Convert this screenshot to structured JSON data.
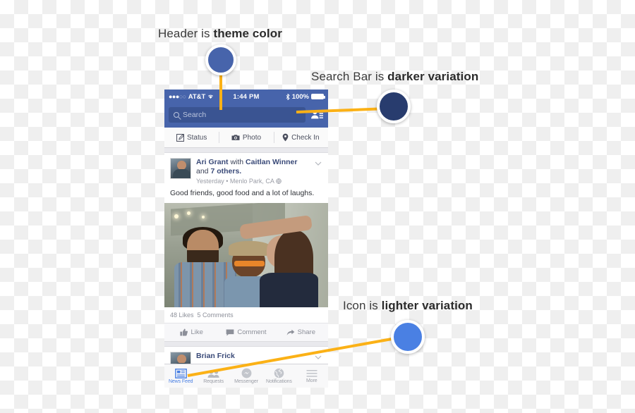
{
  "annotations": [
    {
      "id": "header",
      "plain": "Header is ",
      "emphasis": "theme color",
      "swatch_color": "#4764ab"
    },
    {
      "id": "search",
      "plain": "Search Bar is ",
      "emphasis": "darker variation",
      "swatch_color": "#283c6e"
    },
    {
      "id": "icon",
      "plain": "Icon is ",
      "emphasis": "lighter variation",
      "swatch_color": "#4a80e3"
    }
  ],
  "phone": {
    "status_bar": {
      "signal_dots_filled": 3,
      "signal_dots_hollow": 2,
      "carrier": "AT&T",
      "wifi_icon": "wifi-icon",
      "time": "1:44 PM",
      "bluetooth_icon": "bluetooth-icon",
      "battery_percent": "100%",
      "battery_icon": "battery-full-icon"
    },
    "header": {
      "background_color": "#4764ab",
      "search": {
        "icon": "search-icon",
        "placeholder": "Search",
        "value": "",
        "background_color": "#3a5492"
      },
      "friend_requests_icon": "friend-requests-icon"
    },
    "composer": [
      {
        "icon": "status-compose-icon",
        "label": "Status"
      },
      {
        "icon": "camera-icon",
        "label": "Photo"
      },
      {
        "icon": "location-pin-icon",
        "label": "Check In"
      }
    ],
    "feed": [
      {
        "author": "Ari Grant",
        "with_text": "with",
        "cotag": "Caitlan Winner",
        "and_text": "and",
        "others": "7 others.",
        "timestamp": "Yesterday",
        "separator": "•",
        "location": "Menlo Park, CA",
        "privacy_icon": "globe-icon",
        "chevron_icon": "chevron-down-icon",
        "body": "Good friends, good food and a lot of laughs.",
        "photo_alt": "three-friends-photo",
        "likes": "48 Likes",
        "comments": "5 Comments",
        "actions": [
          {
            "icon": "thumbs-up-icon",
            "label": "Like"
          },
          {
            "icon": "comment-bubble-icon",
            "label": "Comment"
          },
          {
            "icon": "share-arrow-icon",
            "label": "Share"
          }
        ]
      },
      {
        "author": "Brian Frick",
        "chevron_icon": "chevron-down-icon"
      }
    ],
    "tabbar": [
      {
        "icon": "news-feed-icon",
        "label": "News Feed",
        "active": true
      },
      {
        "icon": "friend-requests-icon",
        "label": "Requests",
        "active": false
      },
      {
        "icon": "messenger-icon",
        "label": "Messenger",
        "active": false
      },
      {
        "icon": "globe-notifications-icon",
        "label": "Notifications",
        "active": false
      },
      {
        "icon": "hamburger-more-icon",
        "label": "More",
        "active": false
      }
    ],
    "active_tab_color": "#4a80e3",
    "inactive_tab_color": "#9b9ea6"
  },
  "connector_color": "#fbb116"
}
